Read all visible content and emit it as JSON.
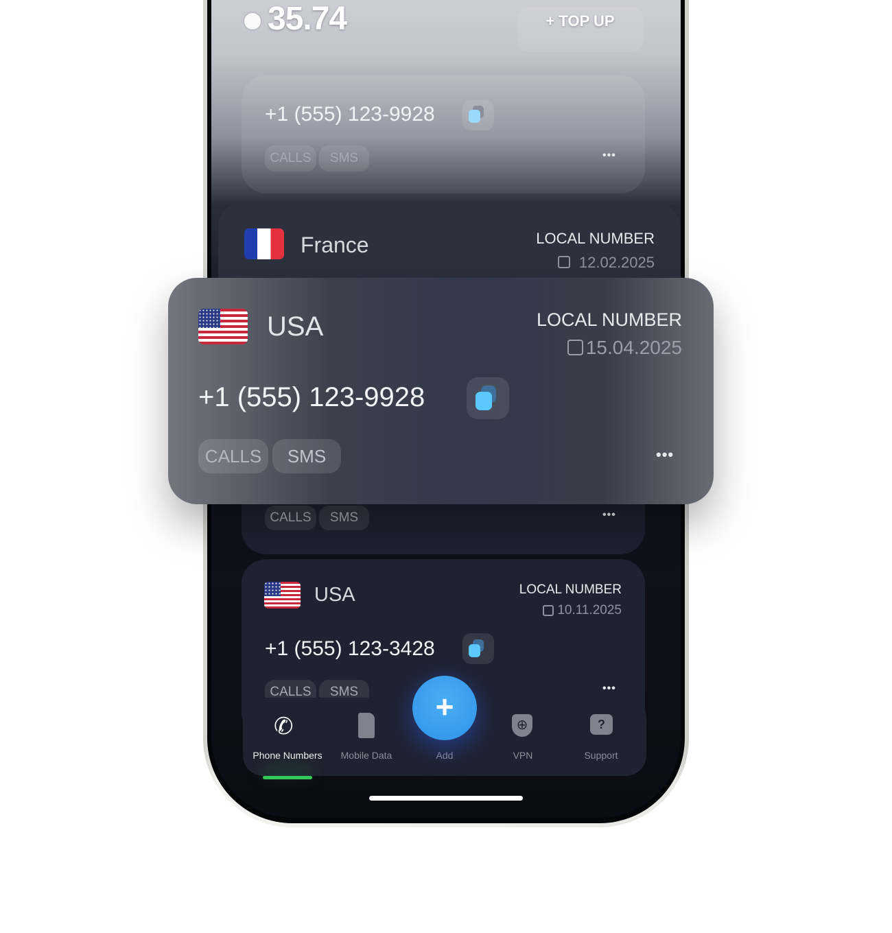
{
  "header": {
    "balance": "35.74",
    "top_up_label": "+ TOP UP"
  },
  "numbers": [
    {
      "number": "+1 (555) 123-9928",
      "tags": [
        "CALLS",
        "SMS"
      ]
    },
    {
      "country": "France",
      "type": "LOCAL NUMBER",
      "date": "12.02.2025"
    },
    {
      "country": "USA",
      "type": "LOCAL NUMBER",
      "date": "15.04.2025",
      "number": "+1 (555) 123-9928",
      "tags": [
        "CALLS",
        "SMS"
      ]
    },
    {
      "tags": [
        "CALLS",
        "SMS"
      ]
    },
    {
      "country": "USA",
      "type": "LOCAL NUMBER",
      "date": "10.11.2025",
      "number": "+1 (555) 123-3428",
      "tags": [
        "CALLS",
        "SMS"
      ]
    }
  ],
  "more_label": "•••",
  "nav": {
    "items": [
      {
        "label": "Phone Numbers",
        "icon": "phone-call-icon",
        "active": true
      },
      {
        "label": "Mobile Data",
        "icon": "sim-card-icon"
      },
      {
        "label": "Add",
        "icon": "plus-icon"
      },
      {
        "label": "VPN",
        "icon": "shield-globe-icon"
      },
      {
        "label": "Support",
        "icon": "question-bubble-icon"
      }
    ],
    "add_symbol": "+"
  },
  "colors": {
    "accent": "#3aa0f0",
    "active_indicator": "#34c759",
    "copy_icon": "#5ac8fa"
  }
}
